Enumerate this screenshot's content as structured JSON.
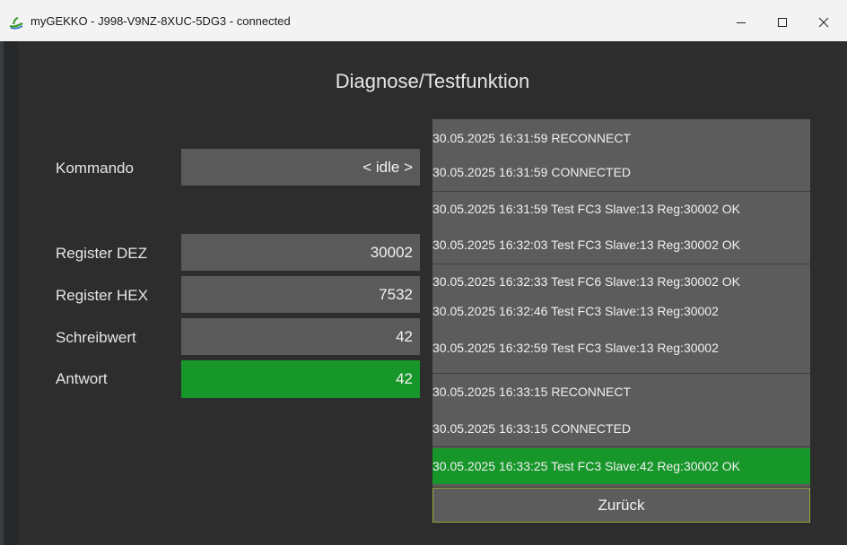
{
  "window": {
    "title": "myGEKKO - J998-V9NZ-8XUC-5DG3 - connected",
    "icon": "gekko-app-icon"
  },
  "page": {
    "title": "Diagnose/Testfunktion"
  },
  "form": {
    "kommando_label": "Kommando",
    "kommando_value": "< idle >",
    "register_dez_label": "Register DEZ",
    "register_dez_value": "30002",
    "register_hex_label": "Register HEX",
    "register_hex_value": "7532",
    "schreibwert_label": "Schreibwert",
    "schreibwert_value": "42",
    "antwort_label": "Antwort",
    "antwort_value": "42"
  },
  "log": {
    "entries": [
      "30.05.2025 16:31:59 RECONNECT",
      "30.05.2025 16:31:59 CONNECTED",
      "30.05.2025 16:31:59 Test FC3 Slave:13 Reg:30002 OK",
      "30.05.2025 16:32:03 Test FC3 Slave:13 Reg:30002 OK",
      "30.05.2025 16:32:33 Test FC6 Slave:13 Reg:30002 OK",
      "30.05.2025 16:32:46 Test FC3 Slave:13 Reg:30002",
      "30.05.2025 16:32:59 Test FC3 Slave:13 Reg:30002",
      "30.05.2025 16:33:15 RECONNECT",
      "30.05.2025 16:33:15 CONNECTED",
      "30.05.2025 16:33:25 Test FC3 Slave:42 Reg:30002 OK"
    ]
  },
  "buttons": {
    "back_label": "Zurück"
  },
  "colors": {
    "background": "#2d2d2d",
    "field": "#5a5a5a",
    "success_green": "#17962a",
    "back_button_border": "#9aa83a"
  }
}
